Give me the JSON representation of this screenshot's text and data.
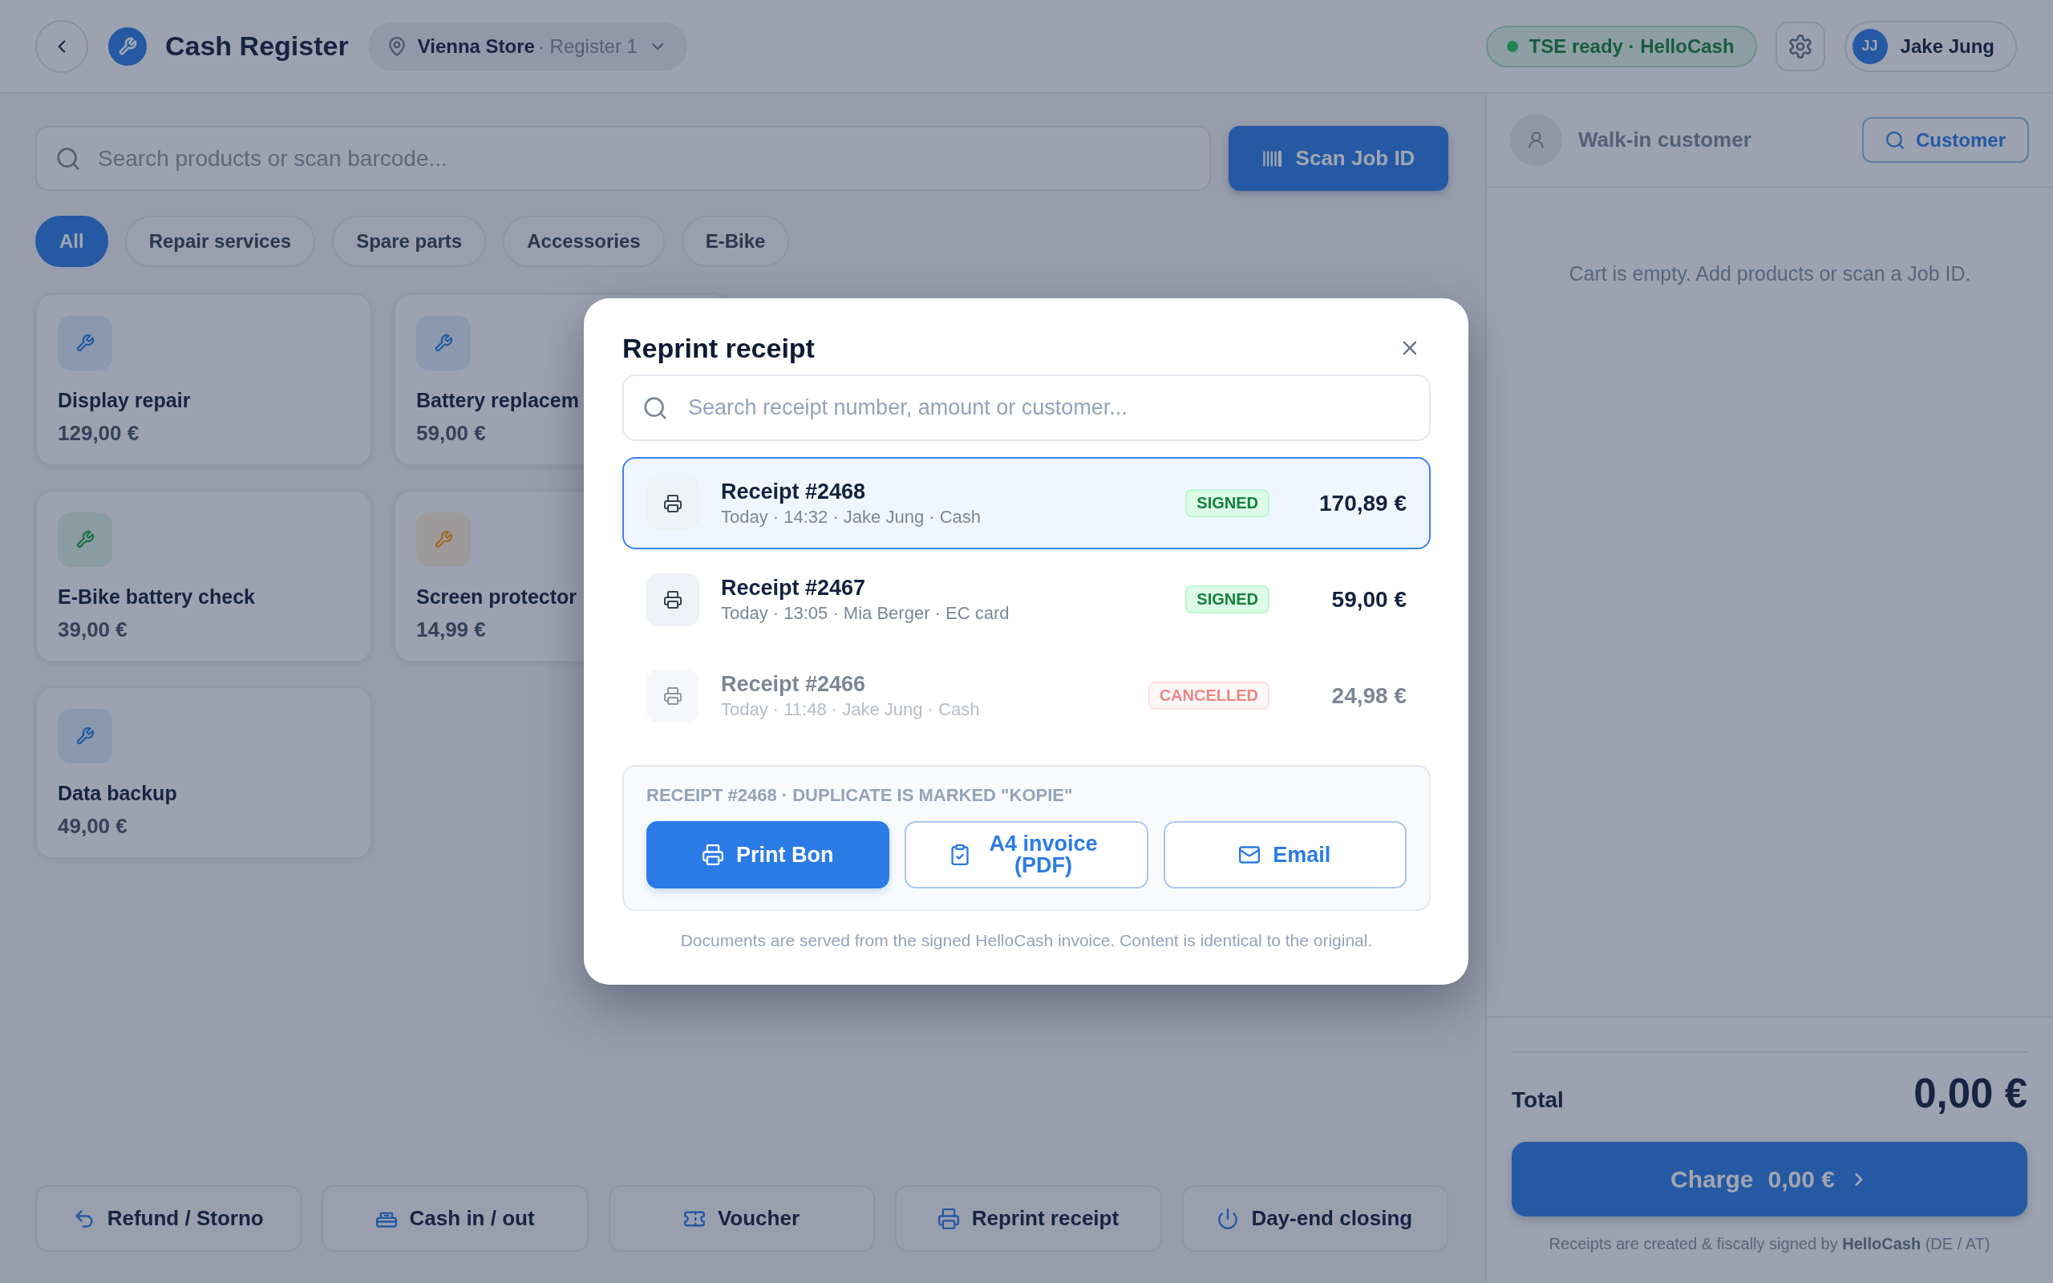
{
  "header": {
    "title": "Cash Register",
    "store": {
      "name": "Vienna Store",
      "register": "· Register 1"
    },
    "tse_status": "TSE ready · HelloCash",
    "user": {
      "initials": "JJ",
      "name": "Jake Jung"
    }
  },
  "search": {
    "placeholder": "Search products or scan barcode..."
  },
  "scan_button": "Scan Job ID",
  "categories": [
    {
      "label": "All",
      "selected": true
    },
    {
      "label": "Repair services",
      "selected": false
    },
    {
      "label": "Spare parts",
      "selected": false
    },
    {
      "label": "Accessories",
      "selected": false
    },
    {
      "label": "E-Bike",
      "selected": false
    }
  ],
  "products": [
    {
      "name": "Display repair",
      "price": "129,00 €",
      "color": "#8b98ae"
    },
    {
      "name": "Battery replacem",
      "price": "59,00 €",
      "color": "#8b98ae"
    },
    {
      "name": "E-Bike battery check",
      "price": "39,00 €",
      "color": "#8a9ba1"
    },
    {
      "name": "Screen protector",
      "price": "14,99 €",
      "color": "#9d9a9c"
    },
    {
      "name": "Data backup",
      "price": "49,00 €",
      "color": "#8b98ae"
    }
  ],
  "actions": [
    {
      "label": "Refund / Storno",
      "kind": "refund"
    },
    {
      "label": "Cash in / out",
      "kind": "cash"
    },
    {
      "label": "Voucher",
      "kind": "voucher"
    },
    {
      "label": "Reprint receipt",
      "kind": "reprint"
    },
    {
      "label": "Day-end closing",
      "kind": "closing"
    }
  ],
  "cart": {
    "customer": "Walk-in customer",
    "customer_button": "Customer",
    "empty_message": "Cart is empty. Add products or scan a Job ID.",
    "total_label": "Total",
    "total": "0,00 €",
    "charge_button": {
      "label": "Charge",
      "amount": "0,00 €"
    },
    "footnote": "Receipts are created & fiscally signed by **HelloCash** (DE / AT)"
  },
  "dialog": {
    "title": "Reprint receipt",
    "search": {
      "placeholder": "Search receipt number, amount or customer..."
    },
    "receipts": [
      {
        "number": "Receipt #2468",
        "details": "Today · 14:32 · Jake Jung · Cash",
        "status": "SIGNED",
        "kind": "signed",
        "amount": "170,89 €",
        "selected": true
      },
      {
        "number": "Receipt #2467",
        "details": "Today · 13:05 · Mia Berger · EC card",
        "status": "SIGNED",
        "kind": "signed",
        "amount": "59,00 €",
        "selected": false
      },
      {
        "number": "Receipt #2466",
        "details": "Today · 11:48 · Jake Jung · Cash",
        "status": "CANCELLED",
        "kind": "cancelled",
        "amount": "24,98 €",
        "selected": false
      }
    ],
    "options": {
      "heading": "RECEIPT #2468 · DUPLICATE IS MARKED \"KOPIE\"",
      "buttons": [
        {
          "label": "Print Bon",
          "kind": "print",
          "primary": true
        },
        {
          "label": "A4 invoice (PDF)",
          "kind": "invoice",
          "primary": false
        },
        {
          "label": "Email",
          "kind": "email",
          "primary": false
        }
      ]
    },
    "note": "Documents are served from the signed HelloCash invoice. Content is identical to the original."
  }
}
